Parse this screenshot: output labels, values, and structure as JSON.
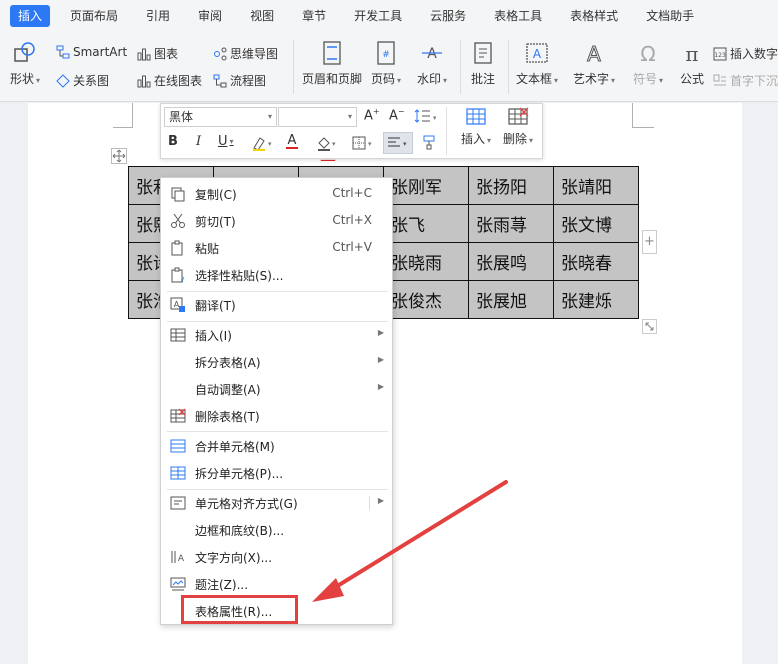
{
  "tabs": [
    "插入",
    "页面布局",
    "引用",
    "审阅",
    "视图",
    "章节",
    "开发工具",
    "云服务",
    "表格工具",
    "表格样式",
    "文档助手"
  ],
  "active_tab_index": 0,
  "ribbon": {
    "shape": "形状",
    "smartart": "SmartArt",
    "chart": "图表",
    "mindmap": "思维导图",
    "relation": "关系图",
    "online_chart": "在线图表",
    "flowchart": "流程图",
    "header_footer": "页眉和页脚",
    "page_num": "页码",
    "watermark": "水印",
    "comment": "批注",
    "textbox": "文本框",
    "art_text": "艺术字",
    "symbol": "符号",
    "formula": "公式",
    "insert_number": "插入数字",
    "dropcap": "首字下沉"
  },
  "minitoolbar": {
    "font_name": "黑体",
    "font_size": "",
    "insert": "插入",
    "delete": "删除"
  },
  "table": {
    "rows": [
      [
        "张利",
        "",
        "",
        "张刚军",
        "张扬阳",
        "张靖阳"
      ],
      [
        "张熙",
        "",
        "",
        "张飞",
        "张雨荨",
        "张文博"
      ],
      [
        "张诗",
        "",
        "",
        "张晓雨",
        "张展鸣",
        "张晓春"
      ],
      [
        "张浩",
        "",
        "",
        "张俊杰",
        "张展旭",
        "张建烁"
      ]
    ]
  },
  "context_menu": {
    "items": [
      {
        "label": "复制(C)",
        "shortcut": "Ctrl+C",
        "icon": "copy-icon"
      },
      {
        "label": "剪切(T)",
        "shortcut": "Ctrl+X",
        "icon": "cut-icon"
      },
      {
        "label": "粘贴",
        "shortcut": "Ctrl+V",
        "icon": "paste-icon"
      },
      {
        "label": "选择性粘贴(S)...",
        "icon": "paste-special-icon"
      },
      {
        "label": "翻译(T)",
        "icon": "translate-icon"
      },
      {
        "label": "插入(I)",
        "submenu": true,
        "icon": "table-insert-icon"
      },
      {
        "label": "拆分表格(A)",
        "submenu": true
      },
      {
        "label": "自动调整(A)",
        "submenu": true
      },
      {
        "label": "删除表格(T)",
        "icon": "table-delete-icon"
      },
      {
        "label": "合并单元格(M)",
        "icon": "merge-cells-icon"
      },
      {
        "label": "拆分单元格(P)...",
        "icon": "split-cells-icon"
      },
      {
        "label": "单元格对齐方式(G)",
        "submenu": true,
        "icon": "cell-align-icon"
      },
      {
        "label": "边框和底纹(B)..."
      },
      {
        "label": "文字方向(X)...",
        "icon": "text-direction-icon"
      },
      {
        "label": "题注(Z)...",
        "icon": "caption-icon"
      },
      {
        "label": "表格属性(R)..."
      }
    ]
  },
  "highlight_color": "#e3413f",
  "accent_color": "#2d78f4"
}
